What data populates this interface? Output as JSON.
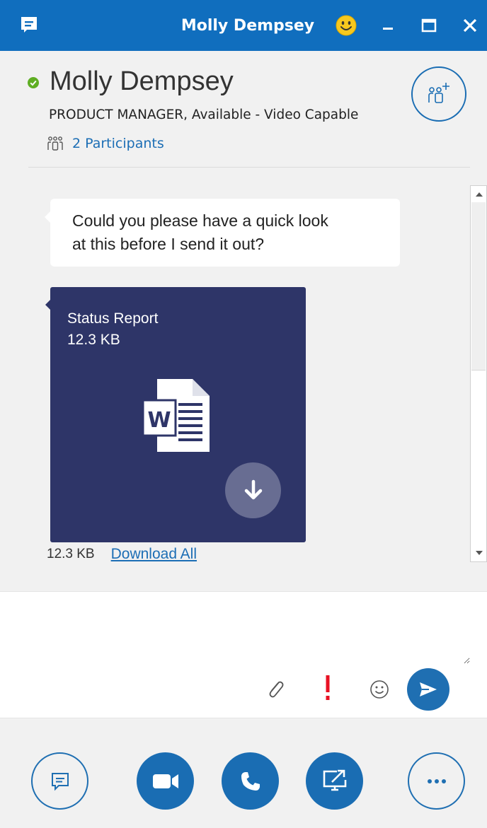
{
  "window": {
    "title": "Molly Dempsey",
    "minimize_label": "–",
    "maximize_label": "□",
    "close_label": "✕"
  },
  "contact": {
    "name": "Molly Dempsey",
    "status_line": "PRODUCT MANAGER,  Available - Video Capable",
    "presence": "available",
    "participants_label": "2 Participants"
  },
  "conversation": {
    "messages": [
      {
        "text_line_1": "Could you please have a quick look",
        "text_line_2": "at this before I send it out?"
      }
    ],
    "attachment": {
      "file_name": "Status Report",
      "file_size": "12.3 KB",
      "type_icon": "word-document-icon"
    },
    "files_total_size": "12.3 KB",
    "download_all_label": "Download All"
  },
  "compose": {
    "value": "",
    "placeholder": ""
  },
  "colors": {
    "brand_blue": "#106ebe",
    "accent_blue": "#1a6db3",
    "presence_green": "#5fae23",
    "file_card": "#2e3568",
    "high_importance": "#e81123"
  }
}
